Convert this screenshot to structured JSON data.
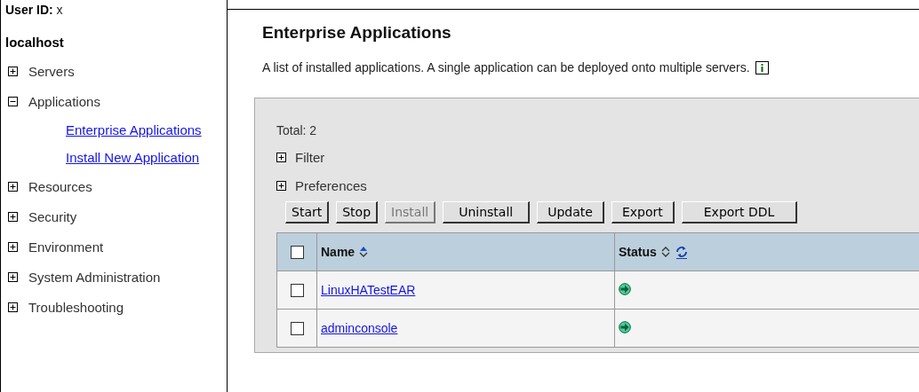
{
  "user": {
    "label": "User ID:",
    "value": "x"
  },
  "sidebar": {
    "host": "localhost",
    "items": [
      {
        "label": "Servers",
        "expanded": false
      },
      {
        "label": "Applications",
        "expanded": true,
        "children": [
          {
            "label": "Enterprise Applications"
          },
          {
            "label": "Install New Application"
          }
        ]
      },
      {
        "label": "Resources",
        "expanded": false
      },
      {
        "label": "Security",
        "expanded": false
      },
      {
        "label": "Environment",
        "expanded": false
      },
      {
        "label": "System Administration",
        "expanded": false
      },
      {
        "label": "Troubleshooting",
        "expanded": false
      }
    ]
  },
  "page": {
    "title": "Enterprise Applications",
    "description": "A list of installed applications. A single application can be deployed onto multiple servers."
  },
  "panel": {
    "total": "Total: 2",
    "sections": [
      {
        "label": "Filter",
        "expanded": false
      },
      {
        "label": "Preferences",
        "expanded": false
      }
    ],
    "buttons": [
      {
        "label": "Start",
        "disabled": false
      },
      {
        "label": "Stop",
        "disabled": false
      },
      {
        "label": "Install",
        "disabled": true
      },
      {
        "label": "Uninstall",
        "disabled": false
      },
      {
        "label": "Update",
        "disabled": false
      },
      {
        "label": "Export",
        "disabled": false
      },
      {
        "label": "Export DDL",
        "disabled": false
      }
    ],
    "table": {
      "select_all": {
        "checked": false
      },
      "columns": [
        "Name",
        "Status"
      ],
      "rows": [
        {
          "name": "LinuxHATestEAR",
          "checked": false
        },
        {
          "name": "adminconsole",
          "checked": false
        }
      ]
    }
  }
}
